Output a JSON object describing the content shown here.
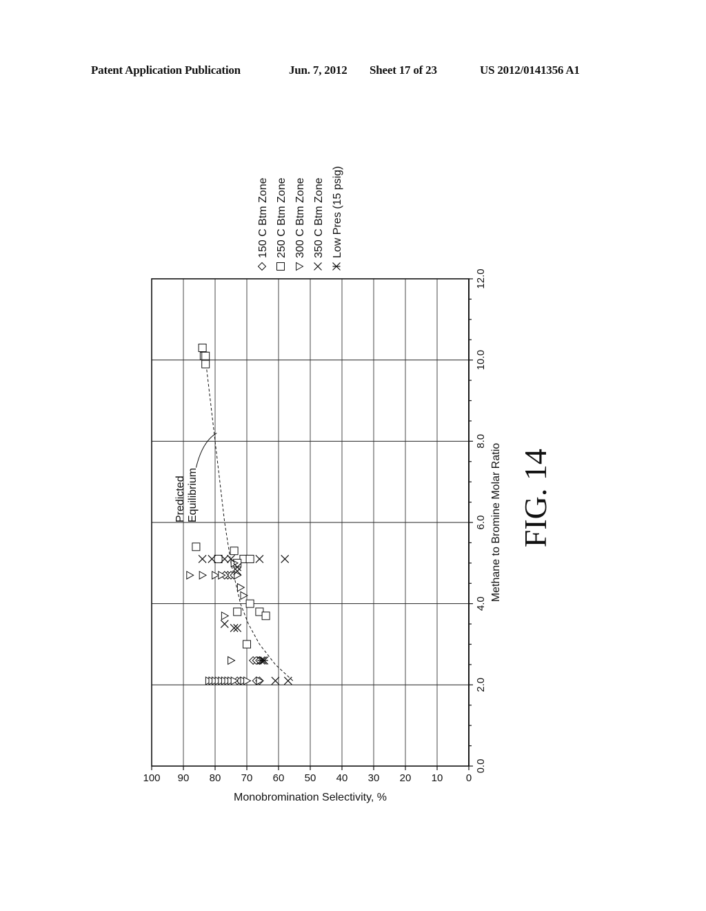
{
  "header": {
    "publication": "Patent Application Publication",
    "date": "Jun. 7, 2012",
    "sheet": "Sheet 17 of 23",
    "number": "US 2012/0141356 A1"
  },
  "figure_label": "FIG. 14",
  "chart_data": {
    "type": "scatter",
    "orientation": "rotated 90° counter-clockwise",
    "title": "",
    "xlabel": "Methane to Bromine Molar Ratio",
    "ylabel": "Monobromination Selectivity, %",
    "xlim": [
      0,
      12
    ],
    "ylim": [
      0,
      100
    ],
    "xticks": [
      "0.0",
      "2.0",
      "4.0",
      "6.0",
      "8.0",
      "10.0",
      "12.0"
    ],
    "yticks": [
      "0",
      "10",
      "20",
      "30",
      "40",
      "50",
      "60",
      "70",
      "80",
      "90",
      "100"
    ],
    "grid": true,
    "legend_position": "right",
    "series": [
      {
        "name": "150 C Btm Zone",
        "marker": "diamond",
        "points": [
          [
            2.1,
            67
          ],
          [
            2.1,
            66
          ],
          [
            2.6,
            68
          ],
          [
            2.6,
            67
          ],
          [
            2.6,
            66
          ],
          [
            4.7,
            76
          ],
          [
            4.7,
            75
          ],
          [
            4.7,
            74
          ],
          [
            4.7,
            77
          ],
          [
            2.1,
            73
          ],
          [
            2.1,
            72
          ]
        ]
      },
      {
        "name": "250 C Btm Zone",
        "marker": "square",
        "points": [
          [
            5.4,
            86
          ],
          [
            5.1,
            79
          ],
          [
            5.3,
            74
          ],
          [
            5.1,
            71
          ],
          [
            5.1,
            69
          ],
          [
            5.0,
            73
          ],
          [
            3.8,
            73
          ],
          [
            3.8,
            66
          ],
          [
            3.7,
            64
          ],
          [
            4.0,
            69
          ],
          [
            3.0,
            70
          ],
          [
            10.3,
            84
          ],
          [
            10.1,
            83.5
          ],
          [
            10.1,
            83
          ],
          [
            9.9,
            83
          ]
        ]
      },
      {
        "name": "300 C Btm Zone",
        "marker": "triangle",
        "points": [
          [
            4.7,
            88
          ],
          [
            4.7,
            84
          ],
          [
            4.7,
            80
          ],
          [
            4.7,
            78
          ],
          [
            4.7,
            73
          ],
          [
            4.4,
            72
          ],
          [
            4.2,
            71
          ],
          [
            3.7,
            77
          ],
          [
            2.6,
            75
          ],
          [
            5.0,
            74
          ],
          [
            2.1,
            82
          ],
          [
            2.1,
            81
          ],
          [
            2.1,
            80
          ],
          [
            2.1,
            79
          ],
          [
            2.1,
            78
          ],
          [
            2.1,
            77
          ],
          [
            2.1,
            76
          ],
          [
            2.1,
            75
          ],
          [
            2.1,
            74
          ],
          [
            2.1,
            71
          ],
          [
            2.1,
            70
          ],
          [
            2.1,
            66
          ]
        ]
      },
      {
        "name": "350 C Btm Zone",
        "marker": "x",
        "points": [
          [
            5.1,
            84
          ],
          [
            5.1,
            81
          ],
          [
            5.1,
            77
          ],
          [
            5.1,
            75
          ],
          [
            5.1,
            66
          ],
          [
            5.1,
            58
          ],
          [
            4.9,
            73
          ],
          [
            4.8,
            73
          ],
          [
            3.5,
            77
          ],
          [
            3.4,
            74
          ],
          [
            3.4,
            73
          ],
          [
            2.6,
            65
          ],
          [
            2.1,
            61
          ],
          [
            2.1,
            57
          ]
        ]
      },
      {
        "name": "Low Pres (15 psig)",
        "marker": "asterisk",
        "points": [
          [
            2.6,
            65.5
          ],
          [
            2.6,
            64.5
          ]
        ]
      }
    ],
    "curve": {
      "name": "Predicted Equilibrium",
      "style": "dashed",
      "points": [
        [
          2.1,
          55.5
        ],
        [
          2.5,
          61
        ],
        [
          3.0,
          66
        ],
        [
          3.5,
          69.5
        ],
        [
          4.0,
          72
        ],
        [
          4.5,
          73.5
        ],
        [
          5.0,
          75
        ],
        [
          6.0,
          77
        ],
        [
          7.0,
          78.5
        ],
        [
          8.0,
          80
        ],
        [
          9.0,
          81.5
        ],
        [
          10.0,
          83
        ],
        [
          10.3,
          83.5
        ]
      ]
    },
    "annotations": [
      {
        "text_lines": [
          "Predicted",
          "Equilibrium"
        ],
        "points_to_x": 8.2
      }
    ]
  }
}
